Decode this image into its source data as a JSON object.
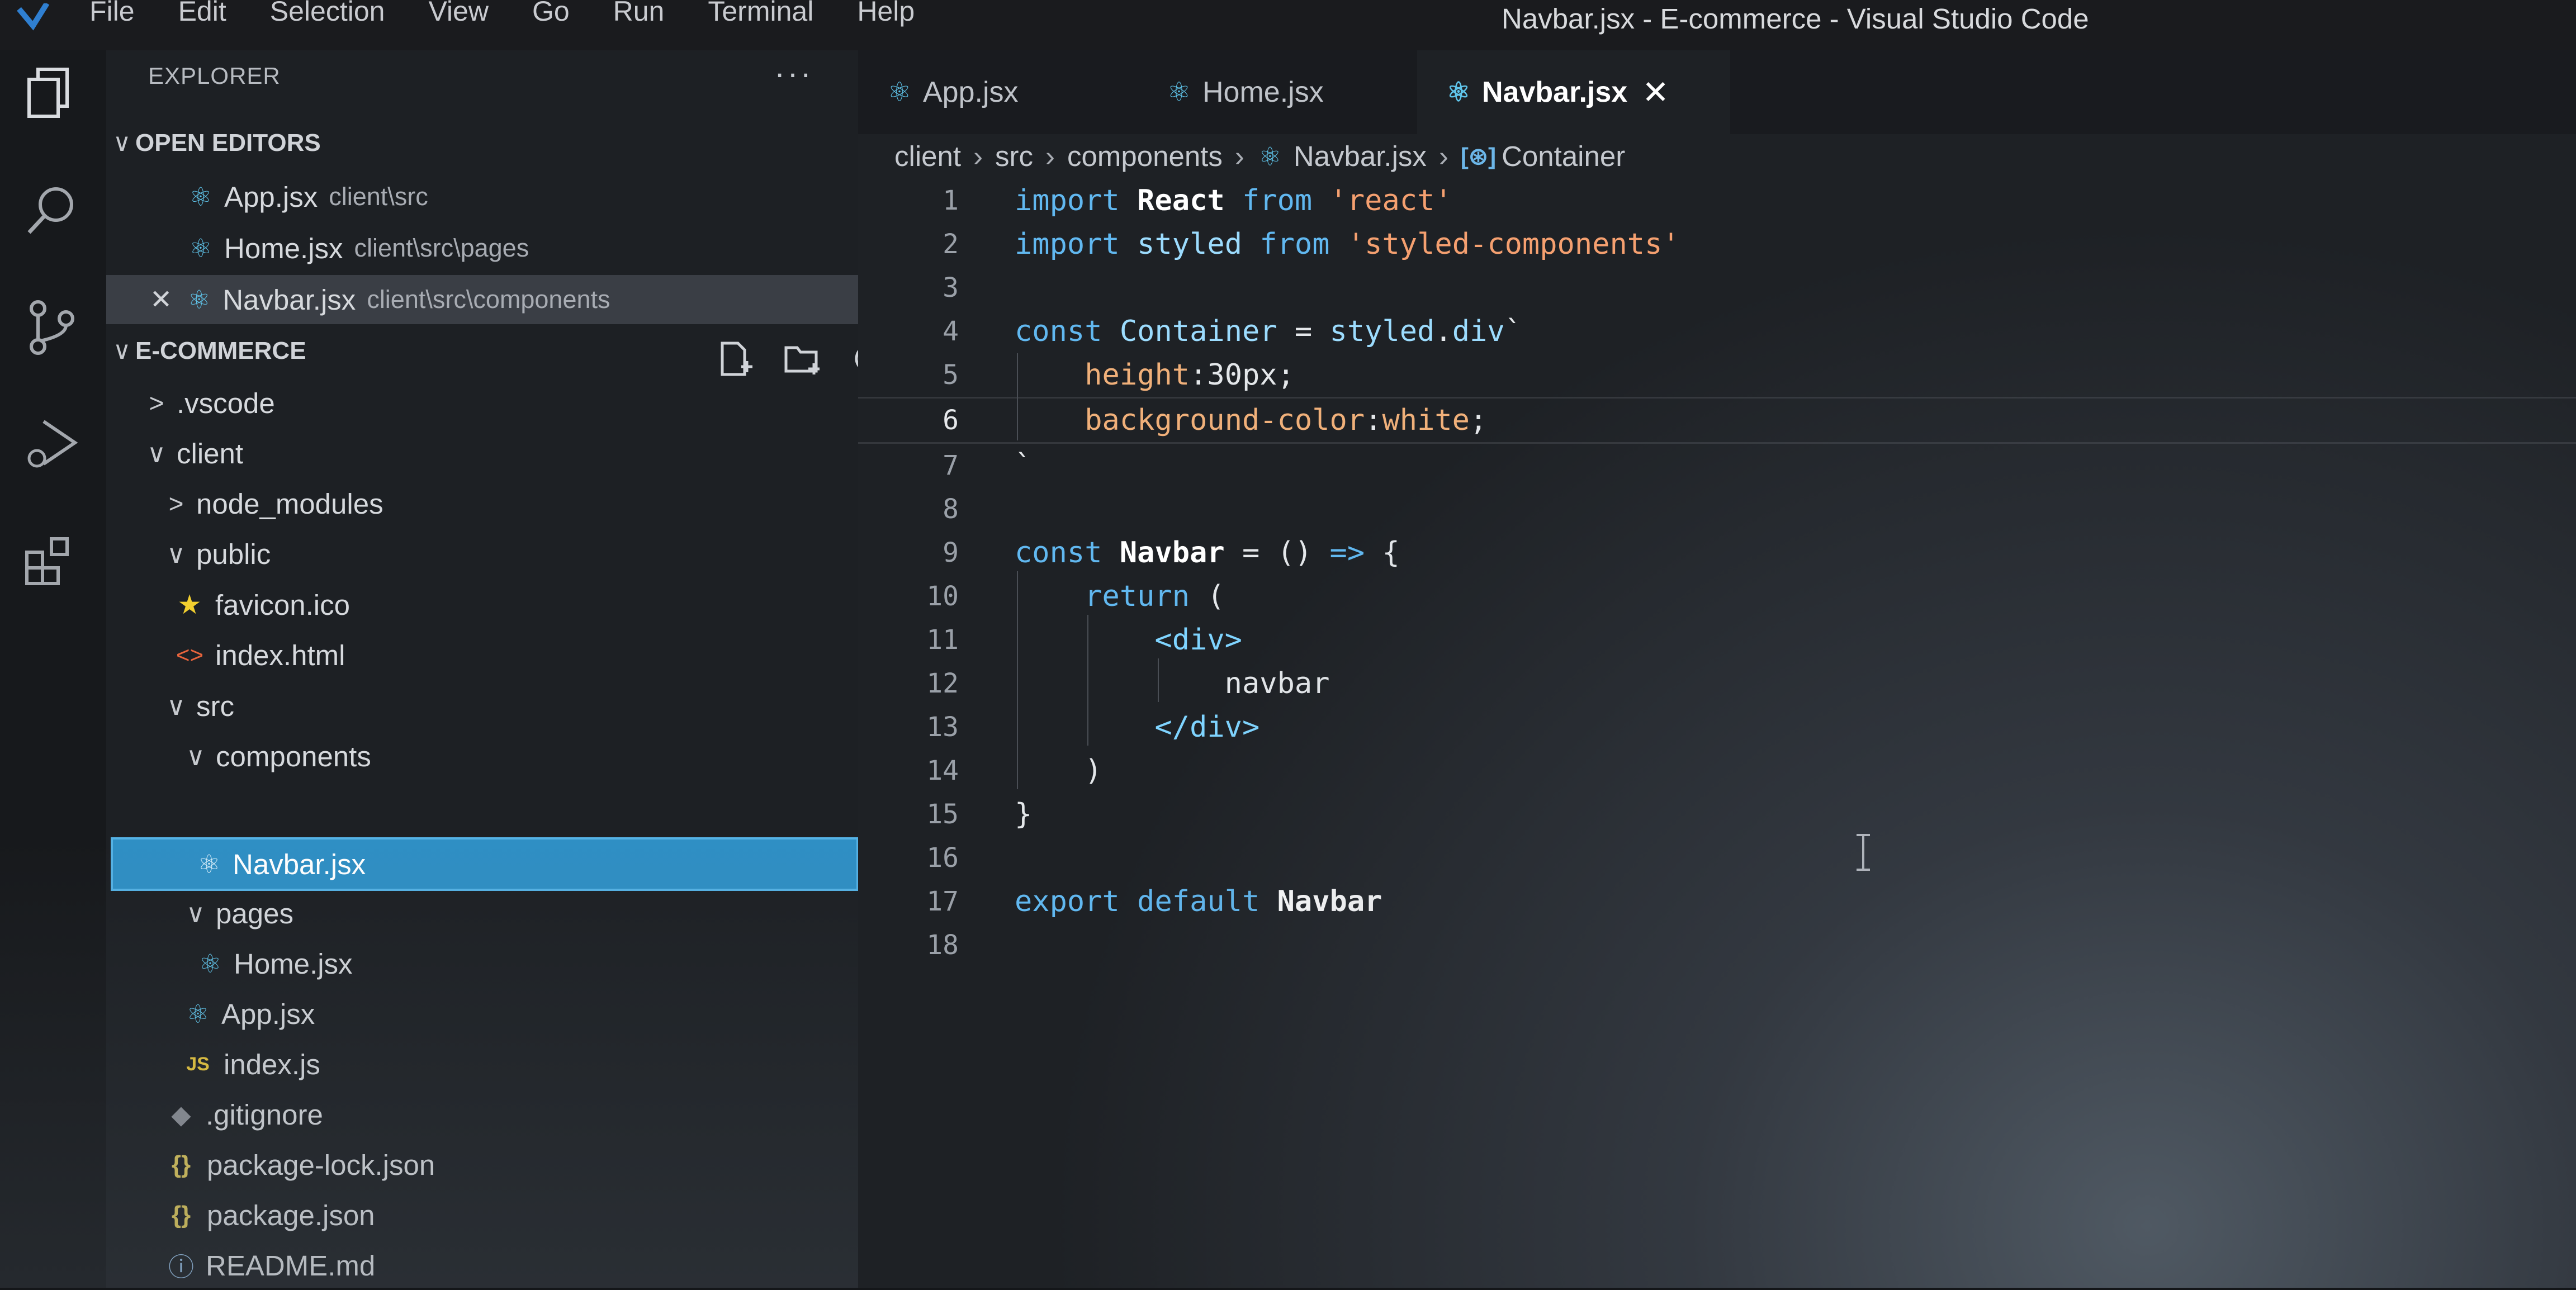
{
  "window": {
    "title": "Navbar.jsx - E-commerce - Visual Studio Code",
    "menu": [
      "File",
      "Edit",
      "Selection",
      "View",
      "Go",
      "Run",
      "Terminal",
      "Help"
    ]
  },
  "activity_bar": [
    "files-icon",
    "search-icon",
    "source-control-icon",
    "run-debug-icon",
    "extensions-icon"
  ],
  "sidebar": {
    "title": "EXPLORER",
    "more": "···",
    "open_editors": {
      "label": "OPEN EDITORS",
      "items": [
        {
          "name": "App.jsx",
          "path": "client\\src"
        },
        {
          "name": "Home.jsx",
          "path": "client\\src\\pages"
        },
        {
          "name": "Navbar.jsx",
          "path": "client\\src\\components"
        }
      ]
    },
    "project": {
      "label": "E-COMMERCE",
      "tree": [
        {
          "label": ".vscode",
          "kind": "folder",
          "open": false
        },
        {
          "label": "client",
          "kind": "folder",
          "open": true
        },
        {
          "label": "node_modules",
          "kind": "folder",
          "open": false
        },
        {
          "label": "public",
          "kind": "folder",
          "open": true
        },
        {
          "label": "favicon.ico",
          "kind": "star"
        },
        {
          "label": "index.html",
          "kind": "html"
        },
        {
          "label": "src",
          "kind": "folder",
          "open": true
        },
        {
          "label": "components",
          "kind": "folder",
          "open": true
        },
        {
          "label": "Navbar.jsx",
          "kind": "react"
        },
        {
          "label": "pages",
          "kind": "folder",
          "open": true
        },
        {
          "label": "Home.jsx",
          "kind": "react"
        },
        {
          "label": "App.jsx",
          "kind": "react"
        },
        {
          "label": "index.js",
          "kind": "js"
        },
        {
          "label": ".gitignore",
          "kind": "git"
        },
        {
          "label": "package-lock.json",
          "kind": "json"
        },
        {
          "label": "package.json",
          "kind": "json"
        },
        {
          "label": "README.md",
          "kind": "info"
        }
      ]
    }
  },
  "icons": {
    "react": "⚛",
    "js": "JS",
    "json": "{}",
    "html": "<>",
    "close": "✕",
    "chev_down": "∨",
    "chev_right": ">"
  },
  "tabs": [
    {
      "label": "App.jsx",
      "active": false
    },
    {
      "label": "Home.jsx",
      "active": false
    },
    {
      "label": "Navbar.jsx",
      "active": true
    }
  ],
  "breadcrumb": [
    "client",
    "src",
    "components",
    "Navbar.jsx",
    "Container"
  ],
  "code_lines": [
    "import React from 'react'",
    "import styled from 'styled-components'",
    "",
    "const Container = styled.div`",
    "    height:30px;",
    "    background-color:white;",
    "`",
    "",
    "const Navbar = () => {",
    "    return (",
    "        <div>",
    "            navbar",
    "        </div>",
    "    )",
    "}",
    "",
    "export default Navbar",
    ""
  ],
  "current_line": 6,
  "colors": {
    "accent_selected": "#2f8fc4",
    "react_icon": "#5fc4ea",
    "keyword": "#61b8f0",
    "string": "#f5a070"
  }
}
